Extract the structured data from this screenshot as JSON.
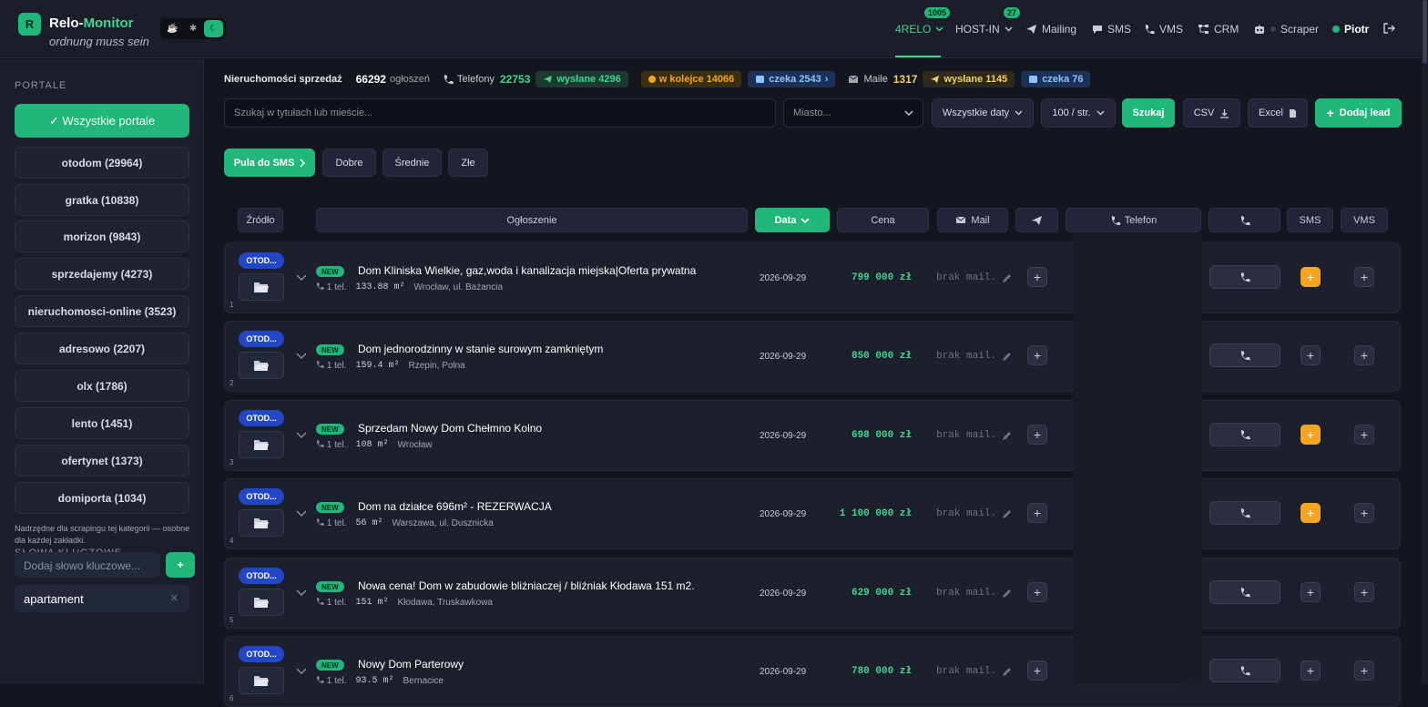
{
  "header": {
    "logo_letter": "R",
    "brand_a": "Relo-",
    "brand_b": "Monitor",
    "tagline": "ordnung muss sein",
    "nav": [
      {
        "label": "4RELO",
        "badge": "1005"
      },
      {
        "label": "HOST-IN",
        "badge": "27"
      },
      {
        "label": "Mailing"
      },
      {
        "label": "SMS"
      },
      {
        "label": "VMS"
      },
      {
        "label": "CRM"
      },
      {
        "label": "Scraper"
      },
      {
        "label": "Piotr"
      }
    ],
    "colors": {
      "accent": "#22b77a",
      "accent_text": "#3fd68e",
      "warning": "#f5a524",
      "info": "#2147c4"
    }
  },
  "sidebar": {
    "portals_heading": "PORTALE",
    "all_portals": "✓ Wszystkie portale",
    "portals": [
      "otodom (29964)",
      "gratka (10838)",
      "morizon (9843)",
      "sprzedajemy (4273)",
      "nieruchomosci-online (3523)",
      "adresowo (2207)",
      "olx (1786)",
      "lento (1451)",
      "ofertynet (1373)",
      "domiporta (1034)"
    ],
    "keywords_heading": "SŁOWA KLUCZOWE — NIERUCHOMOŚCI",
    "keywords_note": "Nadrzędne dla scrapingu tej kategorii — osobne dla każdej zakładki.",
    "keyword_placeholder": "Dodaj słowo kluczowe...",
    "keyword_add": "+",
    "keyword_tag": "apartament"
  },
  "stats": {
    "label": "Nieruchomości sprzedaż",
    "count": "66292",
    "count_suffix": "ogłoszeń",
    "phones_label": "Telefony",
    "phones": "22753",
    "sent": "wysłane 4296",
    "queue": "w kolejce 14066",
    "waiting": "czeka 2543",
    "mails_label": "Maile",
    "mails": "1317",
    "mails_sent": "wysłane 1145",
    "mails_waiting": "czeka 76"
  },
  "filters": {
    "search_placeholder": "Szukaj w tytułach lub mieście...",
    "city_placeholder": "Miasto...",
    "dates": "Wszystkie daty",
    "per_page": "100 / str.",
    "search_btn": "Szukaj",
    "csv": "CSV",
    "excel": "Excel",
    "add_lead": "Dodaj lead"
  },
  "quick": {
    "sms_pool": "Pula do SMS",
    "good": "Dobre",
    "medium": "Średnie",
    "bad": "Złe"
  },
  "columns": {
    "source": "Źródło",
    "listing": "Ogłoszenie",
    "date": "Data",
    "price": "Cena",
    "mail": "Mail",
    "phone": "Telefon",
    "sms": "SMS",
    "vms": "VMS"
  },
  "rows": [
    {
      "src": "OTOD...",
      "num": "1",
      "badge": "NEW",
      "title": "Dom Kliniska Wielkie, gaz,woda i kanalizacja miejska|Oferta prywatna",
      "phones": "1 tel.",
      "area": "133.88 m²",
      "loc": "Wrocław, ul. Bażancia",
      "date": "2026-09-29",
      "price": "799 000 zł",
      "mail": "brak mail.",
      "sms_hot": true
    },
    {
      "src": "OTOD...",
      "num": "2",
      "badge": "NEW",
      "title": "Dom jednorodzinny w stanie surowym zamkniętym",
      "phones": "1 tel.",
      "area": "159.4 m²",
      "loc": "Rzepin, Polna",
      "date": "2026-09-29",
      "price": "850 000 zł",
      "mail": "brak mail.",
      "sms_hot": false
    },
    {
      "src": "OTOD...",
      "num": "3",
      "badge": "NEW",
      "title": "Sprzedam Nowy Dom Chełmno Kolno",
      "phones": "1 tel.",
      "area": "108 m²",
      "loc": "Wrocław",
      "date": "2026-09-29",
      "price": "698 000 zł",
      "mail": "brak mail.",
      "sms_hot": true
    },
    {
      "src": "OTOD...",
      "num": "4",
      "badge": "NEW",
      "title": "Dom na działce 696m² - REZERWACJA",
      "phones": "1 tel.",
      "area": "56 m²",
      "loc": "Warszawa, ul. Dusznicka",
      "date": "2026-09-29",
      "price": "1 100 000 zł",
      "mail": "brak mail.",
      "sms_hot": true
    },
    {
      "src": "OTOD...",
      "num": "5",
      "badge": "NEW",
      "title": "Nowa cena! Dom w zabudowie bliźniaczej / bliźniak Kłodawa 151 m2.",
      "phones": "1 tel.",
      "area": "151 m²",
      "loc": "Kłodawa, Truskawkowa",
      "date": "2026-09-29",
      "price": "629 000 zł",
      "mail": "brak mail.",
      "sms_hot": false
    },
    {
      "src": "OTOD...",
      "num": "6",
      "badge": "NEW",
      "title": "Nowy Dom Parterowy",
      "phones": "1 tel.",
      "area": "93.5 m²",
      "loc": "Bernacice",
      "date": "2026-09-29",
      "price": "780 000 zł",
      "mail": "brak mail.",
      "sms_hot": false
    }
  ]
}
